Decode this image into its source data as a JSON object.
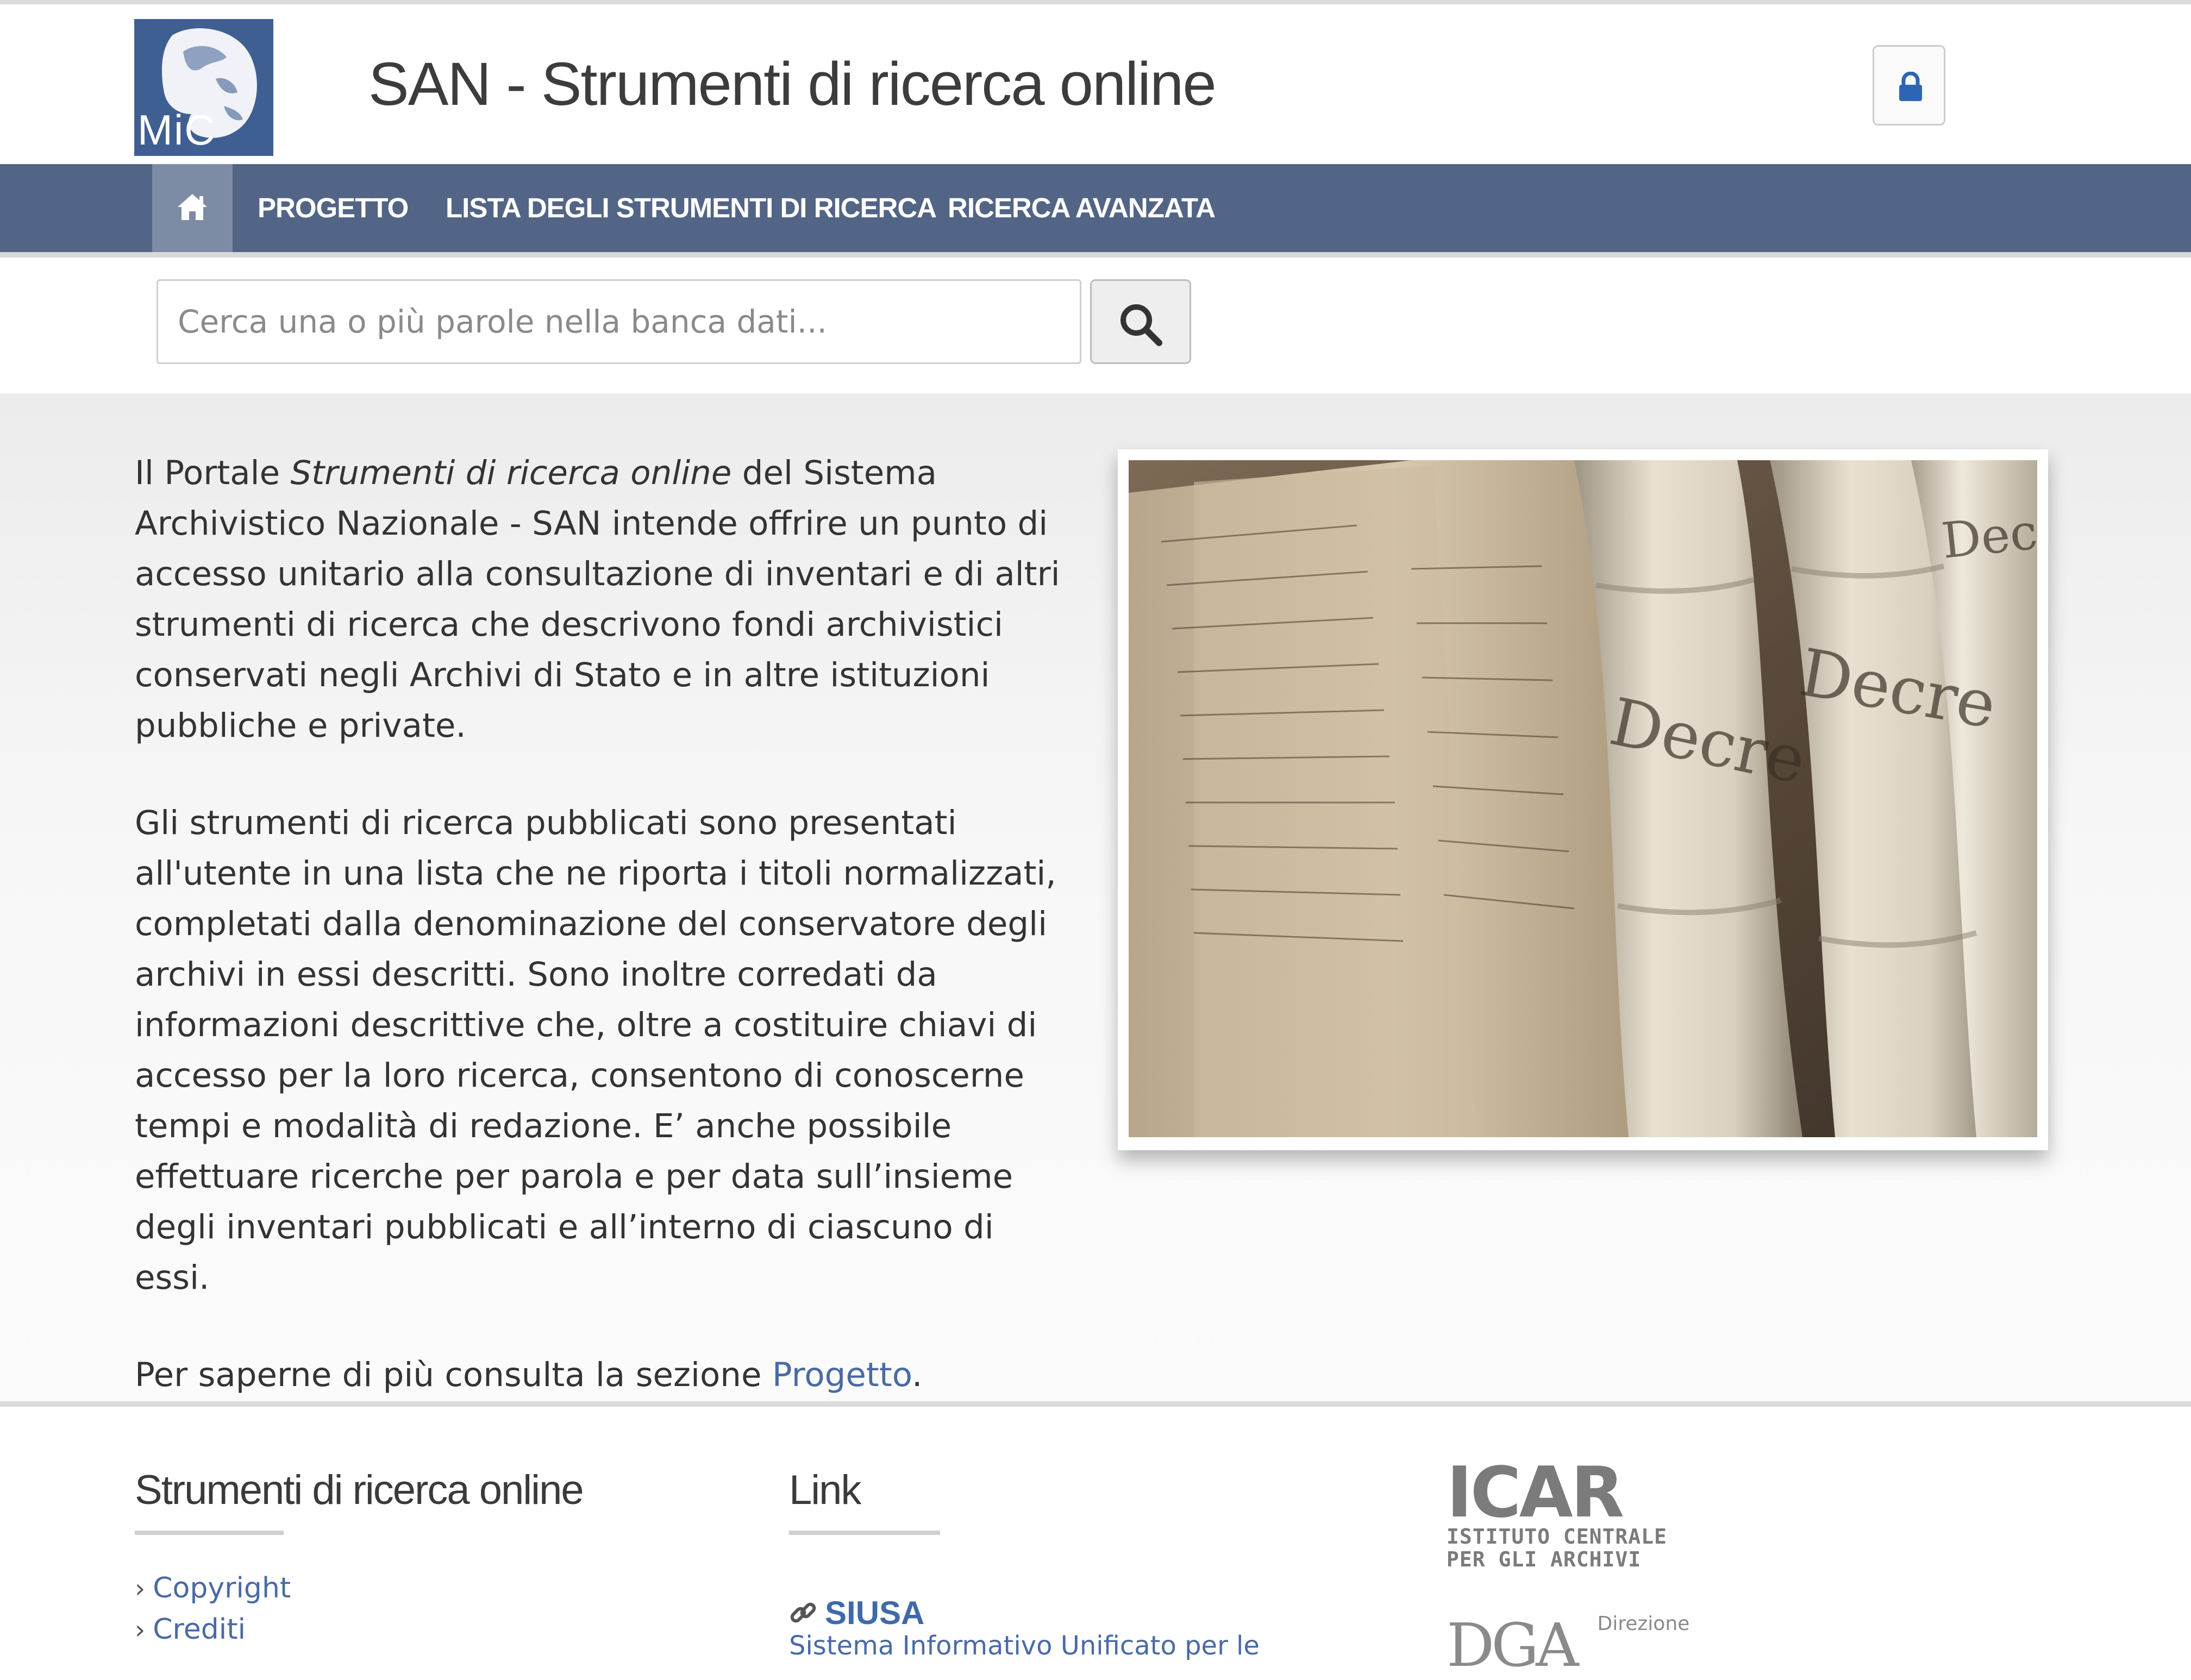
{
  "header": {
    "logo_text": "MiC",
    "site_title": "SAN - Strumenti di ricerca online",
    "login_icon": "lock-icon"
  },
  "nav": {
    "home_icon": "home-icon",
    "items": [
      {
        "label": "PROGETTO"
      },
      {
        "label": "LISTA DEGLI STRUMENTI DI RICERCA"
      },
      {
        "label": "RICERCA AVANZATA"
      }
    ]
  },
  "search": {
    "placeholder": "Cerca una o più parole nella banca dati...",
    "value": "",
    "button_icon": "search-icon"
  },
  "intro": {
    "p1_before": "Il Portale ",
    "p1_em": "Strumenti di ricerca online",
    "p1_after": " del Sistema Archivistico Nazionale - SAN intende offrire un punto di accesso unitario alla consultazione di inventari e di altri strumenti di ricerca che descrivono fondi archivistici conservati negli Archivi di Stato e in altre istituzioni pubbliche e private.",
    "p2": "Gli strumenti di ricerca pubblicati sono presentati all'utente in una lista che ne riporta i titoli normalizzati, completati dalla denominazione del conservatore degli archivi in essi descritti. Sono inoltre corredati da informazioni descrittive che, oltre a costituire chiavi di accesso per la loro ricerca, consentono di conoscerne tempi e modalità di redazione. E’ anche possibile effettuare ricerche per parola e per data sull’insieme degli inventari pubblicati e all’interno di ciascuno di essi.",
    "p3_before": "Per saperne di più consulta la sezione ",
    "p3_link": "Progetto",
    "p3_after": "."
  },
  "footer": {
    "col1_heading": "Strumenti di ricerca online",
    "col1_links": [
      {
        "label": "Copyright"
      },
      {
        "label": "Crediti"
      }
    ],
    "col2_heading": "Link",
    "col2_link": "SIUSA",
    "col2_link_sub": "Sistema Informativo Unificato per le",
    "icar_big": "ICAR",
    "icar_line1": "ISTITUTO CENTRALE",
    "icar_line2": "PER GLI ARCHIVI",
    "dga_mark": "DGA",
    "dga_text": "Direzione"
  },
  "colors": {
    "navbar": "#536586",
    "nav_active": "#7e8ba4",
    "logo_bg": "#3f5f93",
    "link": "#4a6aa5",
    "lock_icon": "#2e64b4"
  }
}
